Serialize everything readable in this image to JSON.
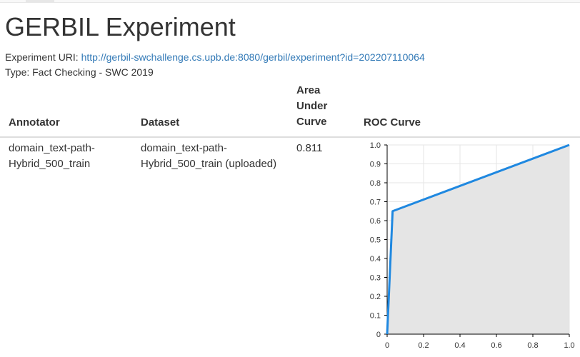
{
  "page": {
    "title": "GERBIL Experiment",
    "uri_label": "Experiment URI:",
    "uri_link": "http://gerbil-swchallenge.cs.upb.de:8080/gerbil/experiment?id=202207110064",
    "type_line": "Type: Fact Checking - SWC 2019"
  },
  "table": {
    "headers": {
      "annotator": "Annotator",
      "dataset": "Dataset",
      "auc": "Area Under Curve",
      "roc": "ROC Curve"
    },
    "rows": [
      {
        "annotator": "domain_text-path-Hybrid_500_train",
        "dataset": "domain_text-path-Hybrid_500_train (uploaded)",
        "auc": "0.811"
      }
    ]
  },
  "chart_data": {
    "type": "area",
    "x": [
      0,
      0.03,
      1.0
    ],
    "y": [
      0,
      0.65,
      1.0
    ],
    "xlim": [
      0,
      1
    ],
    "ylim": [
      0,
      1
    ],
    "x_ticks": [
      "0",
      "0.2",
      "0.4",
      "0.6",
      "0.8",
      "1.0"
    ],
    "y_ticks": [
      "0",
      "0.1",
      "0.2",
      "0.3",
      "0.4",
      "0.5",
      "0.6",
      "0.7",
      "0.8",
      "0.9",
      "1.0"
    ],
    "grid": true,
    "line_color": "#1f88e0",
    "fill_color": "#e5e5e5"
  }
}
